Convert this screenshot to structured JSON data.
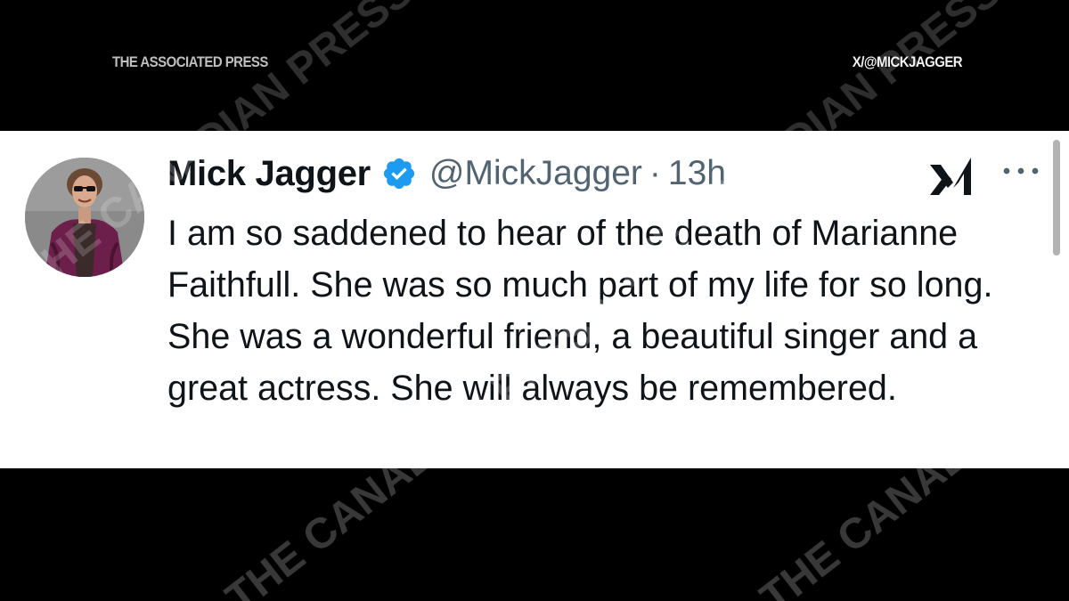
{
  "overlay": {
    "source_credit": "THE ASSOCIATED PRESS",
    "platform_credit": "X/@MICKJAGGER",
    "watermark": "THE CANADIAN PRESS"
  },
  "tweet": {
    "author_name": "Mick Jagger",
    "author_handle": "@MickJagger",
    "separator": "·",
    "timestamp": "13h",
    "text": "I am so saddened to hear of the death of Marianne Faithfull. She was so much part of my life for so long. She was a wonderful friend, a beautiful singer and a great actress. She will always be remembered.",
    "verified_badge_color": "#1d9bf0",
    "icons": [
      "avatar",
      "verified-badge-icon",
      "grok-icon",
      "more-options-icon"
    ]
  },
  "colors": {
    "background": "#000000",
    "card": "#ffffff",
    "primary_text": "#0f1419",
    "secondary_text": "#536471"
  }
}
